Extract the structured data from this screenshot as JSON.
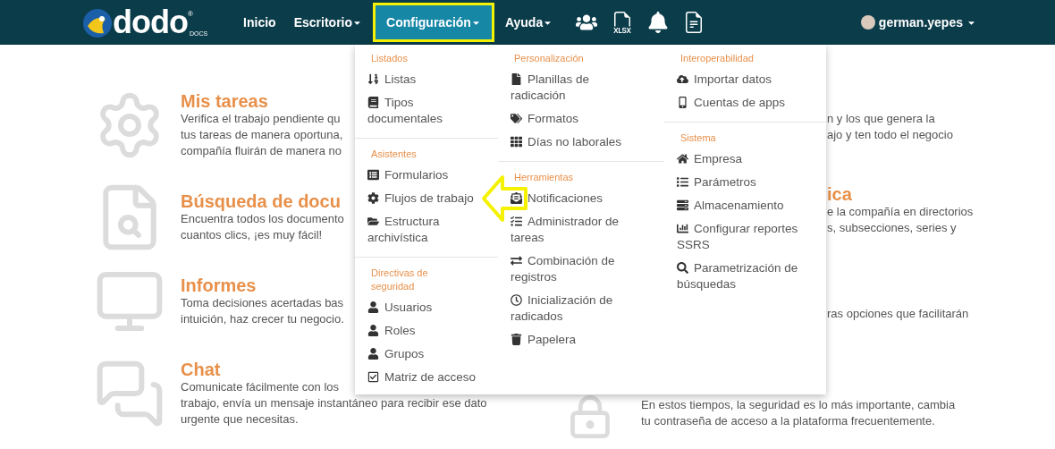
{
  "navbar": {
    "logo": {
      "name": "dodo",
      "mark": "®",
      "sub": "DOCS"
    },
    "items": [
      {
        "label": "Inicio",
        "dropdown": false,
        "selected": false
      },
      {
        "label": "Escritorio",
        "dropdown": true,
        "selected": false
      },
      {
        "label": "Configuración",
        "dropdown": true,
        "selected": true
      },
      {
        "label": "Ayuda",
        "dropdown": true,
        "selected": false
      }
    ],
    "user": {
      "name": "german.yepes",
      "dropdown": true
    }
  },
  "menu": {
    "columns": [
      {
        "sections": [
          {
            "title": "Listados",
            "items": [
              "Listas",
              "Tipos documentales"
            ]
          },
          {
            "title": "Asistentes",
            "items": [
              "Formularios",
              "Flujos de trabajo",
              "Estructura archivística"
            ]
          },
          {
            "title": "Directivas de seguridad",
            "items": [
              "Usuarios",
              "Roles",
              "Grupos",
              "Matriz de acceso"
            ]
          }
        ]
      },
      {
        "sections": [
          {
            "title": "Personalización",
            "items": [
              "Planillas de radicación",
              "Formatos",
              "Días no laborales"
            ]
          },
          {
            "title": "Herramientas",
            "items": [
              "Notificaciones",
              "Administrador de tareas",
              "Combinación de registros",
              "Inicialización de radicados",
              "Papelera"
            ]
          }
        ]
      },
      {
        "sections": [
          {
            "title": "Interoperabilidad",
            "items": [
              "Importar datos",
              "Cuentas de apps"
            ]
          },
          {
            "title": "Sistema",
            "items": [
              "Empresa",
              "Parámetros",
              "Almacenamiento",
              "Configurar reportes SSRS",
              "Parametrización de búsquedas"
            ]
          }
        ]
      }
    ]
  },
  "cards_left": [
    {
      "title": "Mis tareas",
      "lines": [
        "Verifica el trabajo pendiente qu",
        "tus tareas de manera oportuna,",
        "compañía fluirán de manera no"
      ]
    },
    {
      "title": "Búsqueda de docu",
      "lines": [
        "Encuentra todos los documento",
        "cuantos clics, ¡es muy fácil!"
      ]
    },
    {
      "title": "Informes",
      "lines": [
        "Toma decisiones acertadas bas",
        "intuición, haz crecer tu negocio."
      ]
    },
    {
      "title": "Chat",
      "lines": [
        "Comunicate fácilmente con los",
        "trabajo, envía un mensaje instantáneo para recibir ese dato",
        "urgente que necesitas."
      ]
    }
  ],
  "cards_right": [
    {
      "lines": [
        "n y los que genera la",
        "ajo y ten todo el negocio"
      ]
    },
    {
      "title": "ica",
      "lines": [
        "e la compañía en directorios",
        "s, subsecciones, series y"
      ]
    },
    {
      "lines": [
        "ras opciones que facilitarán"
      ]
    },
    {
      "lines": [
        "En estos tiempos, la seguridad es lo más importante, cambia",
        "tu contraseña de acceso a la plataforma frecuentemente."
      ]
    }
  ]
}
